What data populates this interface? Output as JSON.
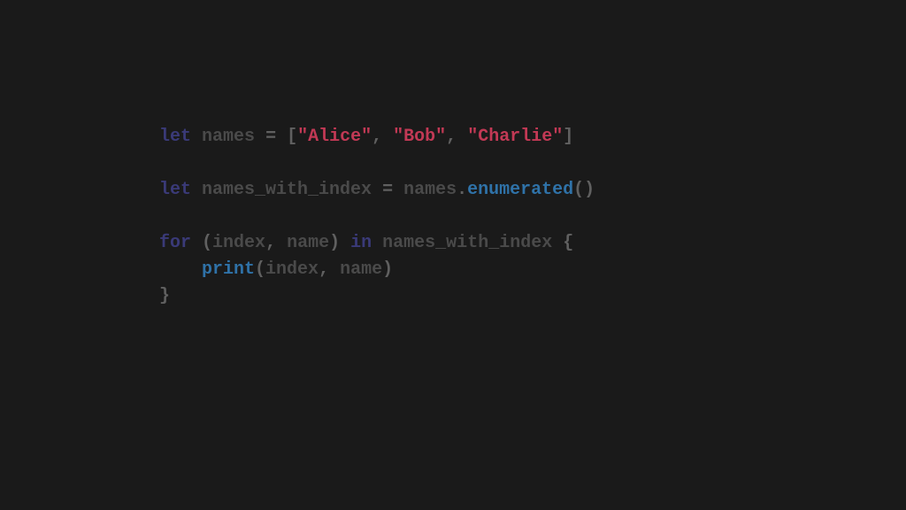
{
  "code": {
    "line1": {
      "kw_let": "let",
      "sp1": " ",
      "name_var": "names",
      "sp2": " ",
      "eq": "=",
      "sp3": " ",
      "lb": "[",
      "str1": "\"Alice\"",
      "comma1": ",",
      "sp4": " ",
      "str2": "\"Bob\"",
      "comma2": ",",
      "sp5": " ",
      "str3": "\"Charlie\"",
      "rb": "]"
    },
    "line2": "",
    "line3": {
      "kw_let": "let",
      "sp1": " ",
      "name_var": "names_with_index",
      "sp2": " ",
      "eq": "=",
      "sp3": " ",
      "name_src": "names",
      "dot": ".",
      "method": "enumerated",
      "parens": "()"
    },
    "line4": "",
    "line5": {
      "kw_for": "for",
      "sp1": " ",
      "lp": "(",
      "name_index": "index",
      "comma": ",",
      "sp2": " ",
      "name_name": "name",
      "rp": ")",
      "sp3": " ",
      "kw_in": "in",
      "sp4": " ",
      "name_iter": "names_with_index",
      "sp5": " ",
      "lbrace": "{"
    },
    "line6": {
      "indent": "    ",
      "method": "print",
      "lp": "(",
      "name_index": "index",
      "comma": ",",
      "sp1": " ",
      "name_name": "name",
      "rp": ")"
    },
    "line7": {
      "rbrace": "}"
    }
  }
}
